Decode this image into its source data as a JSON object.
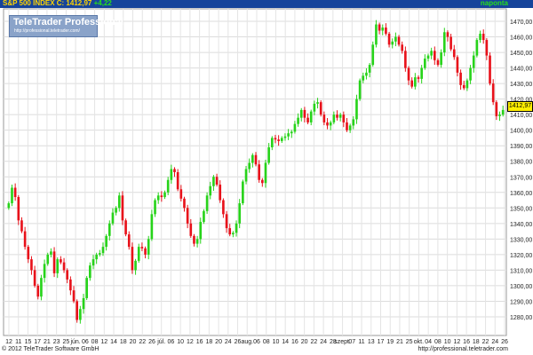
{
  "header": {
    "title": "S&P 500 INDEX C: 1412,97",
    "change": "+4,22",
    "frequency": "naponta"
  },
  "logo": {
    "title": "TeleTrader Professional",
    "url": "http://professional.teletrader.com/"
  },
  "footer": {
    "copyright": "© 2012 TeleTrader Software GmbH",
    "url": "http://professional.teletrader.com"
  },
  "last_price_label": "1412,97",
  "colors": {
    "up": "#27d31a",
    "down": "#e8111a",
    "header_bg": "#16449b",
    "last_price_bg": "#ffef00"
  },
  "chart_data": {
    "type": "candlestick",
    "ylim": [
      1268,
      1478
    ],
    "y_ticks": [
      "1280,00",
      "1290,00",
      "1300,00",
      "1310,00",
      "1320,00",
      "1330,00",
      "1340,00",
      "1350,00",
      "1360,00",
      "1370,00",
      "1380,00",
      "1390,00",
      "1400,00",
      "1410,00",
      "1420,00",
      "1430,00",
      "1440,00",
      "1450,00",
      "1460,00",
      "1470,00"
    ],
    "x_ticks": [
      "12",
      "11",
      "15",
      "17",
      "21",
      "23",
      "25",
      "jún.",
      "06",
      "08",
      "12",
      "14",
      "18",
      "20",
      "22",
      "26",
      "júl.",
      "06",
      "10",
      "12",
      "16",
      "18",
      "20",
      "24",
      "26",
      "aug.",
      "06",
      "08",
      "10",
      "14",
      "16",
      "20",
      "22",
      "24",
      "28",
      "szept.",
      "07",
      "11",
      "13",
      "17",
      "19",
      "21",
      "25",
      "okt.",
      "04",
      "08",
      "10",
      "12",
      "16",
      "18",
      "22",
      "24",
      "26"
    ],
    "closes": [
      1353,
      1363,
      1357,
      1342,
      1335,
      1325,
      1317,
      1310,
      1300,
      1293,
      1305,
      1314,
      1320,
      1322,
      1308,
      1317,
      1315,
      1310,
      1304,
      1297,
      1290,
      1278,
      1285,
      1292,
      1305,
      1313,
      1317,
      1320,
      1321,
      1325,
      1332,
      1340,
      1347,
      1350,
      1358,
      1342,
      1333,
      1325,
      1310,
      1316,
      1325,
      1324,
      1320,
      1330,
      1346,
      1355,
      1358,
      1357,
      1360,
      1368,
      1375,
      1373,
      1362,
      1356,
      1350,
      1340,
      1332,
      1327,
      1330,
      1341,
      1348,
      1358,
      1364,
      1370,
      1365,
      1355,
      1346,
      1337,
      1333,
      1334,
      1340,
      1353,
      1367,
      1375,
      1379,
      1384,
      1378,
      1368,
      1366,
      1379,
      1389,
      1395,
      1394,
      1393,
      1395,
      1396,
      1398,
      1399,
      1404,
      1408,
      1413,
      1408,
      1405,
      1412,
      1417,
      1418,
      1410,
      1405,
      1403,
      1405,
      1410,
      1408,
      1410,
      1405,
      1400,
      1403,
      1407,
      1420,
      1432,
      1435,
      1437,
      1442,
      1455,
      1468,
      1464,
      1466,
      1462,
      1455,
      1457,
      1460,
      1455,
      1451,
      1440,
      1432,
      1428,
      1434,
      1433,
      1440,
      1446,
      1448,
      1451,
      1445,
      1442,
      1450,
      1463,
      1460,
      1452,
      1447,
      1437,
      1429,
      1427,
      1432,
      1440,
      1448,
      1458,
      1462,
      1458,
      1448,
      1430,
      1418,
      1409,
      1410,
      1413
    ]
  }
}
